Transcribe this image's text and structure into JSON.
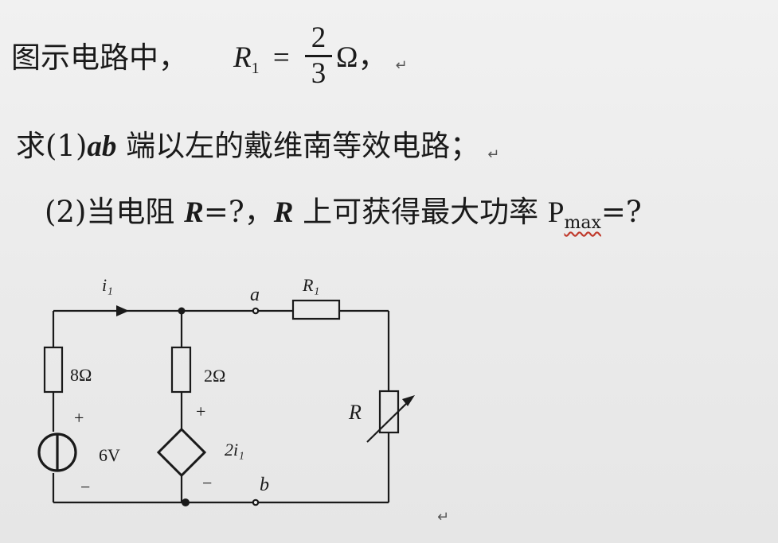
{
  "problem": {
    "line1_prefix": "图示电路中，",
    "r1_symbol": "R",
    "r1_subscript": "1",
    "equals": "=",
    "frac_num": "2",
    "frac_den": "3",
    "unit_comma": "Ω，",
    "line2_prefix": "求(1)",
    "line2_ab": "ab",
    "line2_rest": " 端以左的戴维南等效电路；",
    "line3_prefix": "(2)当电阻 ",
    "line3_r": "R",
    "line3_mid": "=?，",
    "line3_r2": "R",
    "line3_text2": " 上可获得最大功率 ",
    "line3_p": "P",
    "line3_pmax_sub": "max",
    "line3_end": "=?",
    "return_mark": "↵"
  },
  "circuit": {
    "current_label": "i₁",
    "node_a": "a",
    "node_b": "b",
    "r1_label": "R₁",
    "r_label": "R",
    "resistor_8": "8Ω",
    "resistor_2": "2Ω",
    "source_voltage": "6V",
    "dependent_source": "2i₁",
    "plus_left": "+",
    "minus_left": "−",
    "plus_mid": "+",
    "minus_mid": "−"
  }
}
